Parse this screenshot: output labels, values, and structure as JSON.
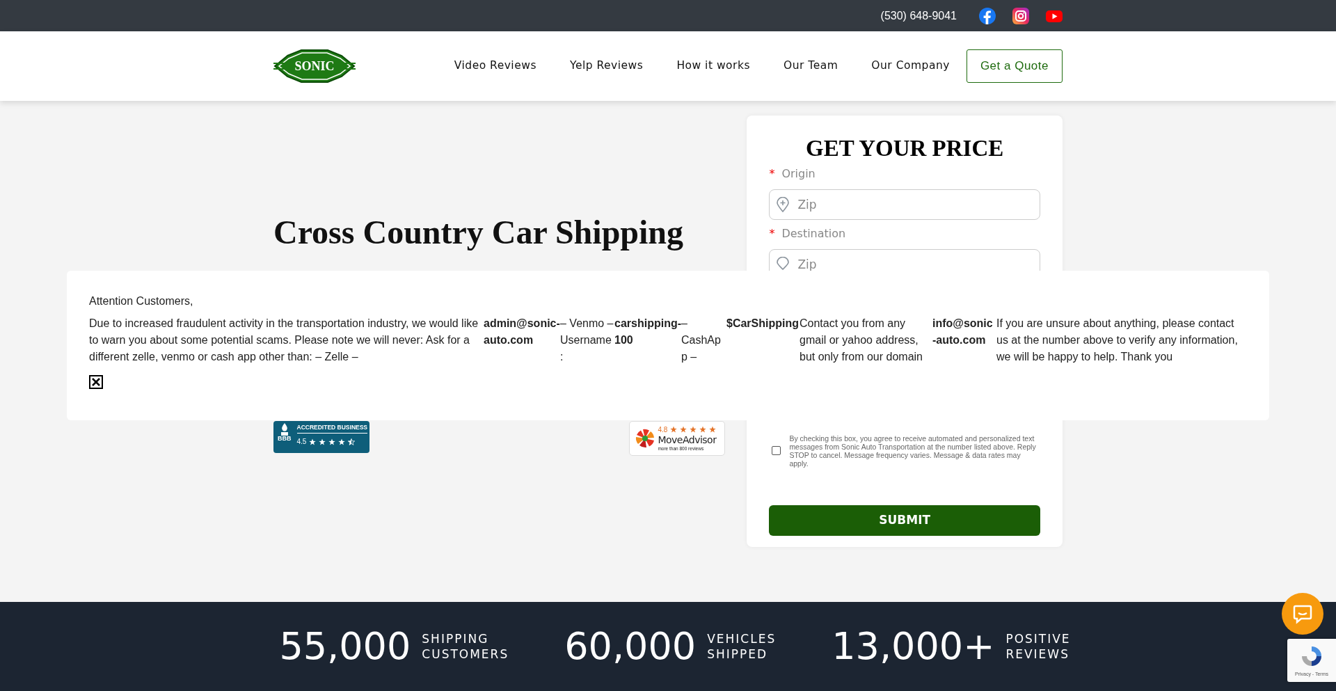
{
  "top_bar": {
    "phone": "(530) 648-9041",
    "social": [
      {
        "kind": "facebook"
      },
      {
        "kind": "instagram"
      },
      {
        "kind": "youtube"
      }
    ]
  },
  "nav": {
    "logo": "SONIC",
    "links": [
      {
        "label": "Video Reviews"
      },
      {
        "label": "Yelp Reviews"
      },
      {
        "label": "How it works"
      },
      {
        "label": "Our Team"
      },
      {
        "label": "Our Company"
      }
    ],
    "cta": "Get a Quote"
  },
  "hero": {
    "title": "Cross Country Car Shipping"
  },
  "badges": {
    "bbb": {
      "logo": "BBB",
      "label": "ACCREDITED BUSINESS",
      "rating": "4.5",
      "stars": 4.5
    },
    "moveadvisor": {
      "rating": "4.8",
      "stars": 5,
      "name": "MoveAdvisor",
      "note": "more than 800 reviews"
    }
  },
  "quote_form": {
    "title": "GET YOUR PRICE",
    "fields": [
      {
        "kind": "origin",
        "required_mark": "*",
        "label": "Origin",
        "placeholder": "Zip"
      },
      {
        "kind": "destination",
        "required_mark": "*",
        "label": "Destination",
        "placeholder": "Zip"
      }
    ],
    "consent": {
      "checked": false,
      "text": "By checking this box, you agree to receive automated and personalized text messages from Sonic Auto Transportation at the number listed above. Reply STOP to cancel. Message frequency varies. Message & data rates may apply."
    },
    "submit": "SUBMIT"
  },
  "notice": {
    "greeting": "Attention Customers,",
    "segments": [
      {
        "text": "Due to increased fraudulent activity in the transportation industry, we would like to warn you about some potential scams. Please note we will never: Ask for a different zelle, venmo or cash app other than: – Zelle –",
        "bold": false
      },
      {
        "text": "admin@sonic-auto.com",
        "bold": true
      },
      {
        "text": "– Venmo – Username:",
        "bold": false
      },
      {
        "text": "carshipping-100",
        "bold": true
      },
      {
        "text": "– CashApp –",
        "bold": false
      },
      {
        "text": "$CarShipping",
        "bold": true
      },
      {
        "text": "Contact you from any gmail or yahoo address, but only from our domain",
        "bold": false
      },
      {
        "text": "info@sonic-auto.com",
        "bold": true
      },
      {
        "text": "If you are unsure about anything, please contact us at the number above to verify any information, we will be happy to help. Thank you",
        "bold": false
      }
    ]
  },
  "stats": [
    {
      "value": "55,000",
      "label": "SHIPPING CUSTOMERS"
    },
    {
      "value": "60,000",
      "label": "VEHICLES SHIPPED"
    },
    {
      "value": "13,000+",
      "label": "POSITIVE REVIEWS"
    }
  ],
  "recaptcha": {
    "links": "Privacy - Terms"
  }
}
